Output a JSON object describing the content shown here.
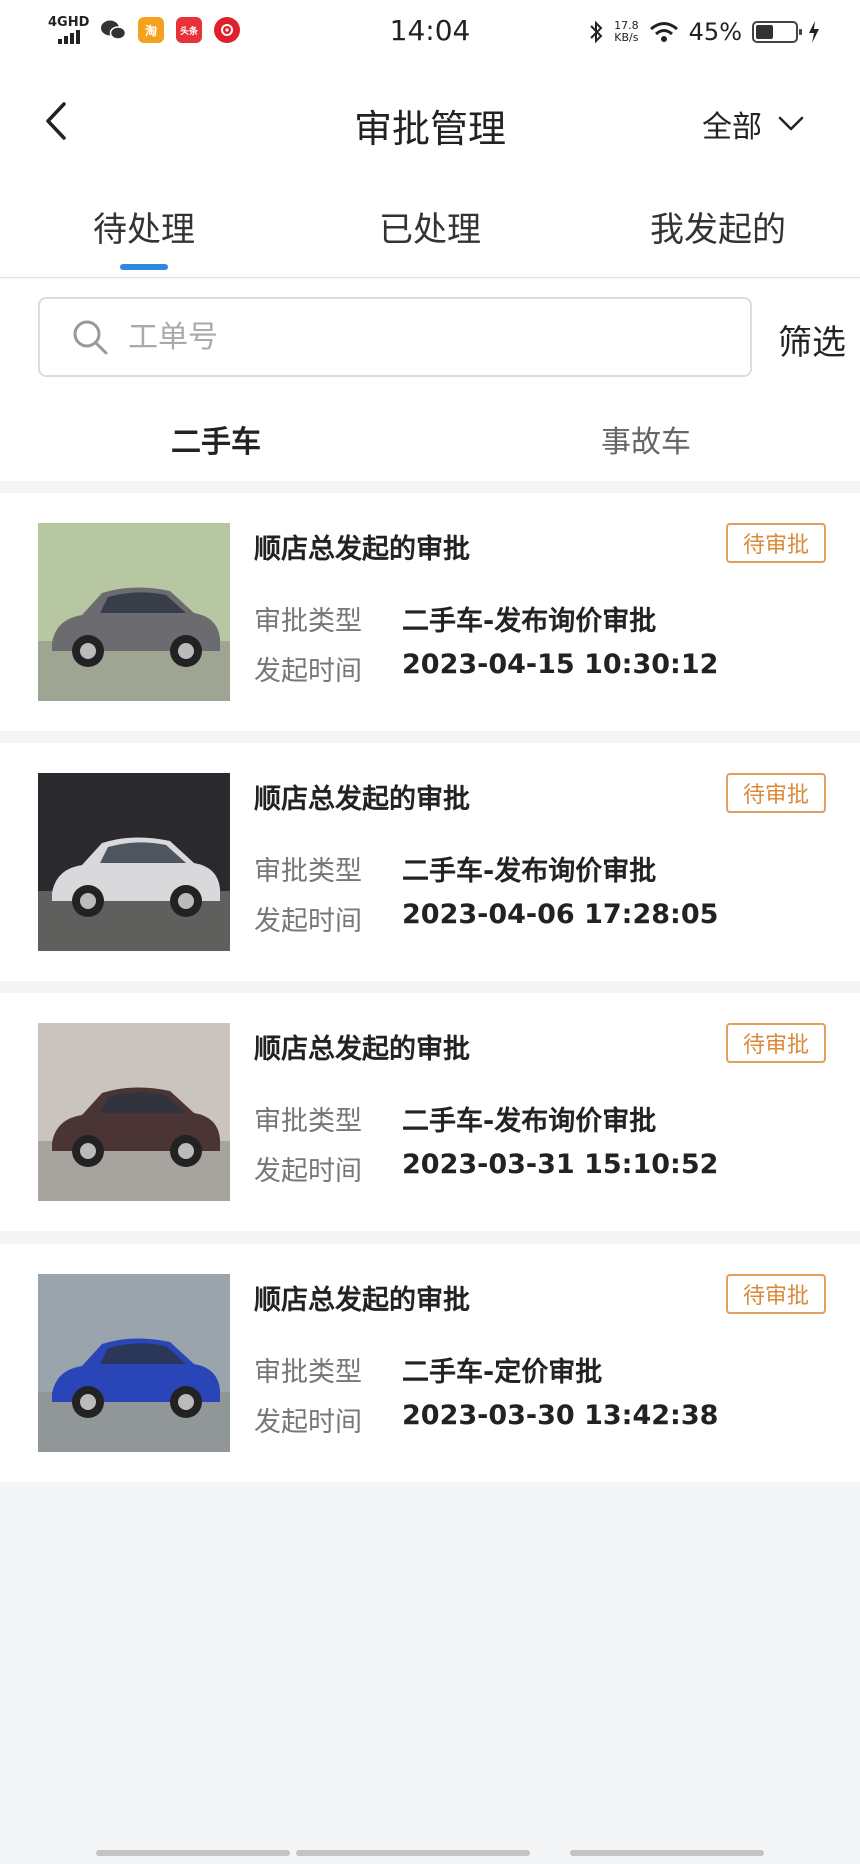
{
  "status_bar": {
    "network": "4GHD",
    "time": "14:04",
    "speed_value": "17.8",
    "speed_unit": "KB/s",
    "battery_percent": "45%",
    "battery_level": 0.45,
    "apps": [
      "wechat-icon",
      "taobao-icon",
      "toutiao-icon",
      "netease-music-icon"
    ],
    "taobao_label": "淘",
    "toutiao_label": "头条"
  },
  "header": {
    "title": "审批管理",
    "filter_select": "全部"
  },
  "tabs": [
    {
      "label": "待处理",
      "active": true
    },
    {
      "label": "已处理",
      "active": false
    },
    {
      "label": "我发起的",
      "active": false
    }
  ],
  "search": {
    "placeholder": "工单号",
    "filter_label": "筛选"
  },
  "subtabs": [
    {
      "label": "二手车",
      "active": true
    },
    {
      "label": "事故车",
      "active": false
    }
  ],
  "labels": {
    "type": "审批类型",
    "time": "发起时间"
  },
  "approvals": [
    {
      "title": "顺店总发起的审批",
      "status": "待审批",
      "type": "二手车-发布询价审批",
      "time": "2023-04-15 10:30:12",
      "car_color": "#6b6b70",
      "bg": "#b7c7a2"
    },
    {
      "title": "顺店总发起的审批",
      "status": "待审批",
      "type": "二手车-发布询价审批",
      "time": "2023-04-06 17:28:05",
      "car_color": "#d9d9dc",
      "bg": "#2a2a2e"
    },
    {
      "title": "顺店总发起的审批",
      "status": "待审批",
      "type": "二手车-发布询价审批",
      "time": "2023-03-31 15:10:52",
      "car_color": "#4a3434",
      "bg": "#c9c4bd"
    },
    {
      "title": "顺店总发起的审批",
      "status": "待审批",
      "type": "二手车-定价审批",
      "time": "2023-03-30 13:42:38",
      "car_color": "#2a45b8",
      "bg": "#9aa4ad"
    }
  ],
  "colors": {
    "accent": "#2f87e0",
    "badge": "#d98a3a"
  }
}
